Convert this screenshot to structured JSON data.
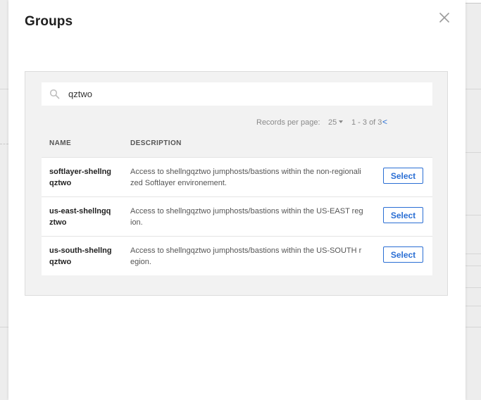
{
  "modal": {
    "title": "Groups"
  },
  "search": {
    "value": "qztwo",
    "placeholder": ""
  },
  "pager": {
    "records_per_page_label": "Records per page:",
    "records_per_page_value": "25",
    "range_text": "1 - 3 of 3",
    "prev_symbol": "<"
  },
  "table": {
    "columns": [
      "NAME",
      "DESCRIPTION"
    ],
    "rows": [
      {
        "name": "softlayer-shellngqztwo",
        "description": "Access to shellngqztwo jumphosts/bastions within the non-regionalized Softlayer environement.",
        "action": "Select"
      },
      {
        "name": "us-east-shellngqztwo",
        "description": "Access to shellngqztwo jumphosts/bastions within the US-EAST region.",
        "action": "Select"
      },
      {
        "name": "us-south-shellngqztwo",
        "description": "Access to shellngqztwo jumphosts/bastions within the US-SOUTH region.",
        "action": "Select"
      }
    ]
  },
  "colors": {
    "accent": "#2a6ed4",
    "panel_bg": "#f2f2f2",
    "text_dark": "#222222"
  },
  "icons": {
    "close": "close-icon",
    "search": "search-icon",
    "caret": "caret-down-icon"
  }
}
